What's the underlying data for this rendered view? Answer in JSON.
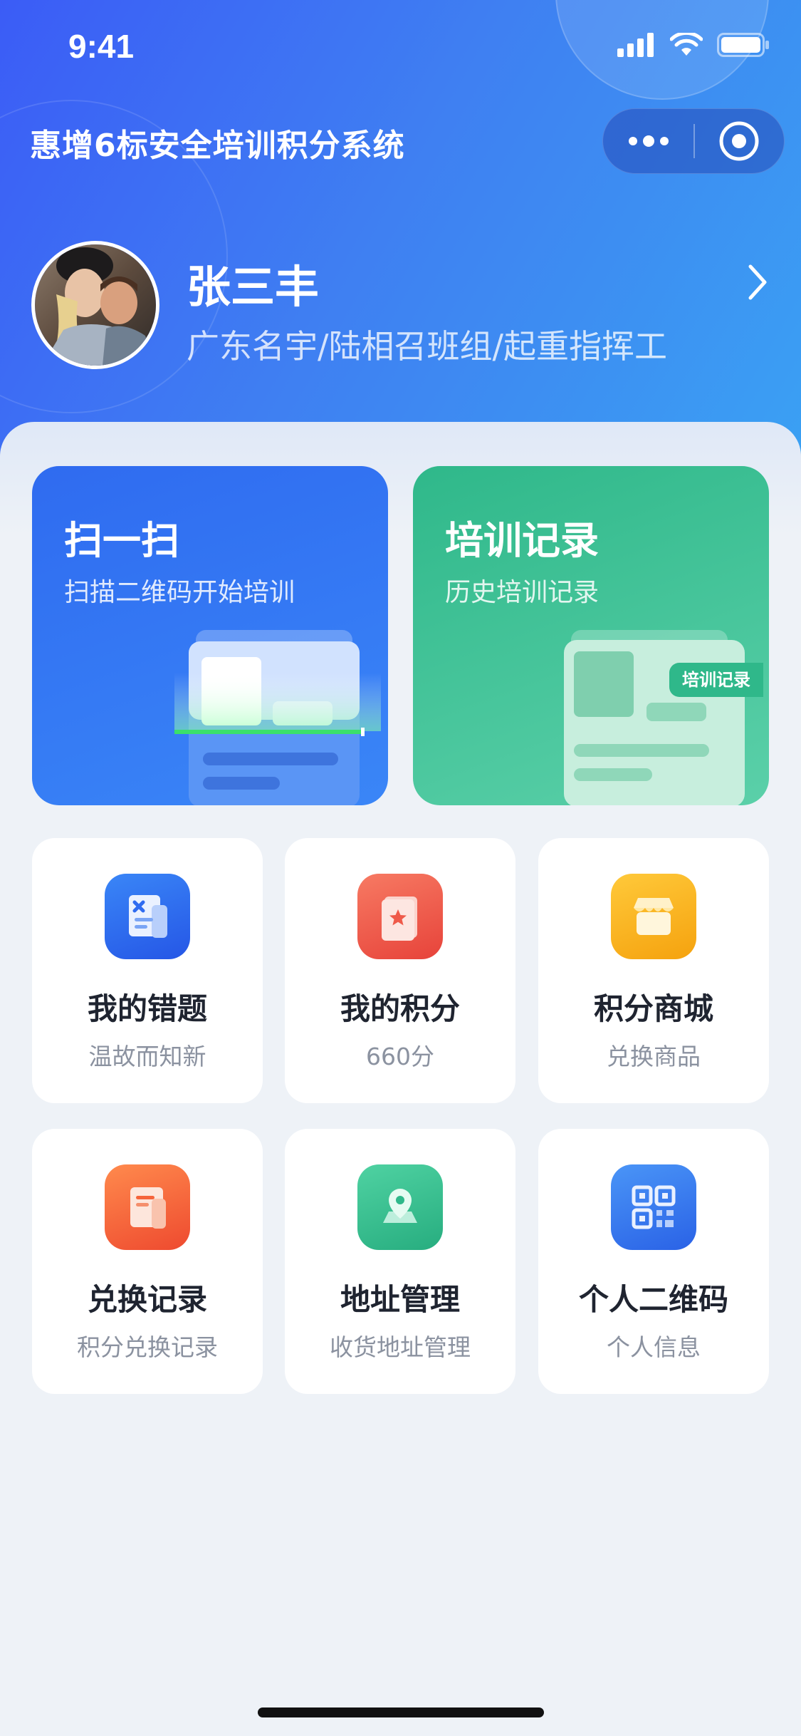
{
  "status_bar": {
    "time": "9:41"
  },
  "header": {
    "title": "惠增6标安全培训积分系统",
    "more_icon": "more-dots-icon",
    "close_icon": "target-circle-icon"
  },
  "profile": {
    "name": "张三丰",
    "org": "广东名宇/陆相召班组/起重指挥工"
  },
  "cards": {
    "scan": {
      "title": "扫一扫",
      "subtitle": "扫描二维码开始培训"
    },
    "training": {
      "title": "培训记录",
      "subtitle": "历史培训记录",
      "badge": "培训记录"
    }
  },
  "grid": [
    {
      "label": "我的错题",
      "sub": "温故而知新",
      "icon": "wrong-questions-icon",
      "color": "#2f6bf0"
    },
    {
      "label": "我的积分",
      "sub": "660分",
      "icon": "points-star-icon",
      "color": "#ef5a4a"
    },
    {
      "label": "积分商城",
      "sub": "兑换商品",
      "icon": "store-icon",
      "color": "#f7b219"
    },
    {
      "label": "兑换记录",
      "sub": "积分兑换记录",
      "icon": "exchange-record-icon",
      "color": "#f5643b"
    },
    {
      "label": "地址管理",
      "sub": "收货地址管理",
      "icon": "location-pin-icon",
      "color": "#2fb88a"
    },
    {
      "label": "个人二维码",
      "sub": "个人信息",
      "icon": "qr-code-icon",
      "color": "#3a7cf0"
    }
  ]
}
